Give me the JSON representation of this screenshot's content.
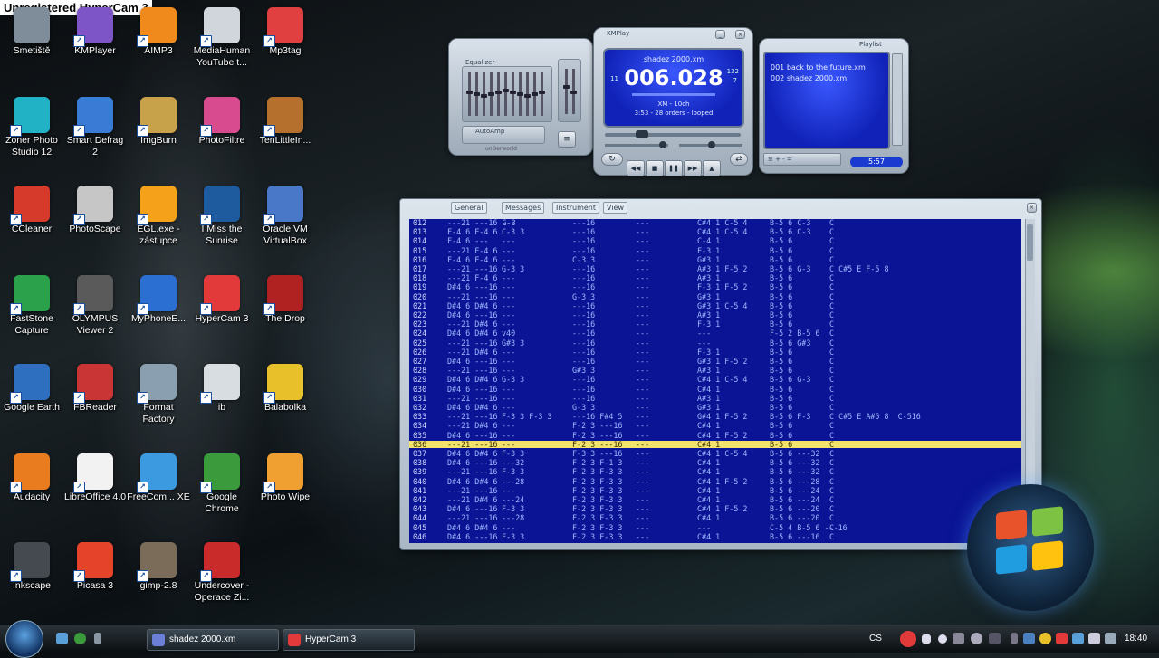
{
  "watermark": "Unregistered HyperCam 3",
  "desktop_icons": [
    {
      "label": "Smetiště",
      "icon": "recycle-bin-icon",
      "color": "#7f8c99",
      "col": 0,
      "row": 0
    },
    {
      "label": "KMPlayer",
      "icon": "kmplayer-icon",
      "color": "#7d55c7",
      "col": 1,
      "row": 0
    },
    {
      "label": "AIMP3",
      "icon": "aimp-icon",
      "color": "#f08a1c",
      "col": 2,
      "row": 0
    },
    {
      "label": "MediaHuman YouTube t...",
      "icon": "microphone-icon",
      "color": "#d0d6dc",
      "col": 3,
      "row": 0
    },
    {
      "label": "Mp3tag",
      "icon": "mp3tag-icon",
      "color": "#e04040",
      "col": 4,
      "row": 0
    },
    {
      "label": "Zoner Photo Studio 12",
      "icon": "zoner-icon",
      "color": "#22b2c6",
      "col": 0,
      "row": 1
    },
    {
      "label": "Smart Defrag 2",
      "icon": "defrag-icon",
      "color": "#3a7bd5",
      "col": 1,
      "row": 1
    },
    {
      "label": "ImgBurn",
      "icon": "disc-icon",
      "color": "#c7a24a",
      "col": 2,
      "row": 1
    },
    {
      "label": "PhotoFiltre",
      "icon": "photofiltre-icon",
      "color": "#d94b8f",
      "col": 3,
      "row": 1
    },
    {
      "label": "TenLittleIn...",
      "icon": "game-icon",
      "color": "#b5702d",
      "col": 4,
      "row": 1
    },
    {
      "label": "CCleaner",
      "icon": "ccleaner-icon",
      "color": "#d63a2b",
      "col": 0,
      "row": 2
    },
    {
      "label": "PhotoScape",
      "icon": "photoscape-icon",
      "color": "#c6c6c6",
      "col": 1,
      "row": 2
    },
    {
      "label": "EGL.exe - zástupce",
      "icon": "burst-icon",
      "color": "#f5a21a",
      "col": 2,
      "row": 2
    },
    {
      "label": "I Miss the Sunrise",
      "icon": "sunrise-icon",
      "color": "#1e5a9e",
      "col": 3,
      "row": 2
    },
    {
      "label": "Oracle VM VirtualBox",
      "icon": "virtualbox-icon",
      "color": "#4a78c8",
      "col": 4,
      "row": 2
    },
    {
      "label": "FastStone Capture",
      "icon": "faststone-icon",
      "color": "#2aa14a",
      "col": 0,
      "row": 3
    },
    {
      "label": "OLYMPUS Viewer 2",
      "icon": "olympus-icon",
      "color": "#5a5a5a",
      "col": 1,
      "row": 3
    },
    {
      "label": "MyPhoneE...",
      "icon": "sync-icon",
      "color": "#2a6fd1",
      "col": 2,
      "row": 3
    },
    {
      "label": "HyperCam 3",
      "icon": "hypercam-icon",
      "color": "#e23a3a",
      "col": 3,
      "row": 3
    },
    {
      "label": "The Drop",
      "icon": "drop-icon",
      "color": "#b02222",
      "col": 4,
      "row": 3
    },
    {
      "label": "Google Earth",
      "icon": "earth-icon",
      "color": "#2f6fc0",
      "col": 0,
      "row": 4
    },
    {
      "label": "FBReader",
      "icon": "book-icon",
      "color": "#c93434",
      "col": 1,
      "row": 4
    },
    {
      "label": "Format Factory",
      "icon": "format-factory-icon",
      "color": "#8aa0b0",
      "col": 2,
      "row": 4
    },
    {
      "label": "ib",
      "icon": "ib-icon",
      "color": "#d8dde2",
      "col": 3,
      "row": 4
    },
    {
      "label": "Balabolka",
      "icon": "smiley-icon",
      "color": "#e8c02a",
      "col": 4,
      "row": 4
    },
    {
      "label": "Audacity",
      "icon": "headphones-icon",
      "color": "#e87c1e",
      "col": 0,
      "row": 5
    },
    {
      "label": "LibreOffice 4.0",
      "icon": "document-icon",
      "color": "#f2f2f2",
      "col": 1,
      "row": 5
    },
    {
      "label": "FreeCom... XE",
      "icon": "freecommander-icon",
      "color": "#3c9be0",
      "col": 2,
      "row": 5
    },
    {
      "label": "Google Chrome",
      "icon": "chrome-icon",
      "color": "#3b9a3b",
      "col": 3,
      "row": 5
    },
    {
      "label": "Photo Wipe",
      "icon": "parrot-icon",
      "color": "#f0a030",
      "col": 4,
      "row": 5
    },
    {
      "label": "Inkscape",
      "icon": "inkscape-icon",
      "color": "#444a50",
      "col": 0,
      "row": 6
    },
    {
      "label": "Picasa 3",
      "icon": "picasa-icon",
      "color": "#e5432a",
      "col": 1,
      "row": 6
    },
    {
      "label": "gimp-2.8",
      "icon": "gimp-icon",
      "color": "#7a6c58",
      "col": 2,
      "row": 6
    },
    {
      "label": "Undercover - Operace Zi...",
      "icon": "uc-icon",
      "color": "#c92a2a",
      "col": 3,
      "row": 6
    }
  ],
  "player": {
    "title": "KMPlay",
    "song": "shadez 2000.xm",
    "time": "006.028",
    "side_top": "132",
    "side_bottom": "7",
    "format": "XM - 10ch",
    "status": "3:53 - 28 orders - looped",
    "eq_label": "Equalizer",
    "eq_auto": "AutoAmp",
    "eq_levels": [
      0.55,
      0.5,
      0.45,
      0.5,
      0.55,
      0.6,
      0.55,
      0.5,
      0.45,
      0.5,
      0.55
    ],
    "brand": "unDerworld",
    "playlist_label": "Playlist",
    "playlist": [
      "001 back to the future.xm",
      "002 shadez 2000.xm"
    ],
    "playlist_time": "5:57",
    "controls": [
      "prev-icon",
      "stop-icon",
      "pause-icon",
      "next-icon",
      "eject-icon"
    ]
  },
  "tracker": {
    "tabs": [
      "General",
      "Messages",
      "Instrument",
      "View"
    ],
    "highlight": 24,
    "rows": [
      [
        "012",
        "---21 ---16 G-3",
        "---",
        "---16",
        "---",
        "C#4 1 C-5 4",
        "B-5 6 C-3",
        "C"
      ],
      [
        "013",
        "F-4 6 F-4 6",
        "C-3 3",
        "---16",
        "---",
        "C#4 1 C-5 4",
        "B-5 6 C-3",
        "C"
      ],
      [
        "014",
        "F-4 6 ---",
        "---",
        "---16",
        "---",
        "C-4 1",
        "B-5 6",
        "C"
      ],
      [
        "015",
        "---21 F-4 6",
        "---",
        "---16",
        "---",
        "F-3 1",
        "B-5 6",
        "C"
      ],
      [
        "016",
        "F-4 6 F-4 6",
        "---",
        "C-3 3",
        "---",
        "G#3 1",
        "B-5 6",
        "C"
      ],
      [
        "017",
        "---21 ---16",
        "G-3 3",
        "---16",
        "---",
        "A#3 1 F-5 2",
        "B-5 6 G-3",
        "C C#5 E F-5 8"
      ],
      [
        "018",
        "---21 F-4 6",
        "---",
        "---16",
        "---",
        "A#3 1",
        "B-5 6",
        "C"
      ],
      [
        "019",
        "D#4 6 ---16",
        "---",
        "---16",
        "---",
        "F-3 1 F-5 2",
        "B-5 6",
        "C"
      ],
      [
        "020",
        "---21 ---16",
        "---",
        "G-3 3",
        "---",
        "G#3 1",
        "B-5 6",
        "C"
      ],
      [
        "021",
        "D#4 6 D#4 6",
        "---",
        "---16",
        "---",
        "G#3 1 C-5 4",
        "B-5 6",
        "C"
      ],
      [
        "022",
        "D#4 6 ---16",
        "---",
        "---16",
        "---",
        "A#3 1",
        "B-5 6",
        "C"
      ],
      [
        "023",
        "---21 D#4 6",
        "---",
        "---16",
        "---",
        "F-3 1",
        "B-5 6",
        "C"
      ],
      [
        "024",
        "D#4 6 D#4 6",
        "v40",
        "---16",
        "---",
        "---",
        "F-5 2 B-5 6",
        "C"
      ],
      [
        "025",
        "---21 ---16",
        "G#3 3",
        "---16",
        "---",
        "---",
        "B-5 6 G#3",
        "C"
      ],
      [
        "026",
        "---21 D#4 6",
        "---",
        "---16",
        "---",
        "F-3 1",
        "B-5 6",
        "C"
      ],
      [
        "027",
        "D#4 6 ---16",
        "---",
        "---16",
        "---",
        "G#3 1 F-5 2",
        "B-5 6",
        "C"
      ],
      [
        "028",
        "---21 ---16",
        "---",
        "G#3 3",
        "---",
        "A#3 1",
        "B-5 6",
        "C"
      ],
      [
        "029",
        "D#4 6 D#4 6",
        "G-3 3",
        "---16",
        "---",
        "C#4 1 C-5 4",
        "B-5 6 G-3",
        "C"
      ],
      [
        "030",
        "D#4 6 ---16",
        "---",
        "---16",
        "---",
        "C#4 1",
        "B-5 6",
        "C"
      ],
      [
        "031",
        "---21 ---16",
        "---",
        "---16",
        "---",
        "A#3 1",
        "B-5 6",
        "C"
      ],
      [
        "032",
        "D#4 6 D#4 6",
        "---",
        "G-3 3",
        "---",
        "G#3 1",
        "B-5 6",
        "C"
      ],
      [
        "033",
        "---21 ---16",
        "F-3 3 F-3 3",
        "---16 F#4 5",
        "---",
        "G#4 1 F-5 2",
        "B-5 6 F-3",
        "C C#5 E A#5 8  C-516"
      ],
      [
        "034",
        "---21 D#4 6",
        "---",
        "F-2 3 ---16",
        "---",
        "C#4 1",
        "B-5 6",
        "C"
      ],
      [
        "035",
        "D#4 6 ---16",
        "---",
        "F-2 3 ---16",
        "---",
        "C#4 1 F-5 2",
        "B-5 6",
        "C"
      ],
      [
        "036",
        "---21 ---16",
        "---",
        "F-2 3 ---16",
        "---",
        "C#4 1",
        "B-5 6",
        "C"
      ],
      [
        "037",
        "D#4 6 D#4 6",
        "F-3 3",
        "F-3 3 ---16",
        "---",
        "C#4 1 C-5 4",
        "B-5 6 ---32",
        "C"
      ],
      [
        "038",
        "D#4 6 ---16",
        "---32",
        "F-2 3 F-1 3",
        "---",
        "C#4 1",
        "B-5 6 ---32",
        "C"
      ],
      [
        "039",
        "---21 ---16",
        "F-3 3",
        "F-2 3 F-3 3",
        "---",
        "C#4 1",
        "B-5 6 ---32",
        "C"
      ],
      [
        "040",
        "D#4 6 D#4 6",
        "---28",
        "F-2 3 F-3 3",
        "---",
        "C#4 1 F-5 2",
        "B-5 6 ---28",
        "C"
      ],
      [
        "041",
        "---21 ---16",
        "---",
        "F-2 3 F-3 3",
        "---",
        "C#4 1",
        "B-5 6 ---24",
        "C"
      ],
      [
        "042",
        "---21 D#4 6",
        "---24",
        "F-2 3 F-3 3",
        "---",
        "C#4 1",
        "B-5 6 ---24",
        "C"
      ],
      [
        "043",
        "D#4 6 ---16",
        "F-3 3",
        "F-2 3 F-3 3",
        "---",
        "C#4 1 F-5 2",
        "B-5 6 ---20",
        "C"
      ],
      [
        "044",
        "---21 ---16",
        "---28",
        "F-2 3 F-3 3",
        "---",
        "C#4 1",
        "B-5 6 ---20",
        "C"
      ],
      [
        "045",
        "D#4 6 D#4 6",
        "---",
        "F-2 3 F-3 3",
        "---",
        "---",
        "C-5 4 B-5 6 ---16",
        "C"
      ],
      [
        "046",
        "D#4 6 ---16",
        "F-3 3",
        "F-2 3 F-3 3",
        "---",
        "C#4 1",
        "B-5 6 ---16",
        "C"
      ]
    ]
  },
  "taskbar": {
    "tasks": [
      {
        "label": "shadez 2000.xm",
        "icon": "kmplayer-task-icon",
        "color": "#6b7fd6"
      },
      {
        "label": "HyperCam 3",
        "icon": "hypercam-task-icon",
        "color": "#e23a3a"
      }
    ],
    "lang": "CS",
    "clock": "18:40"
  }
}
